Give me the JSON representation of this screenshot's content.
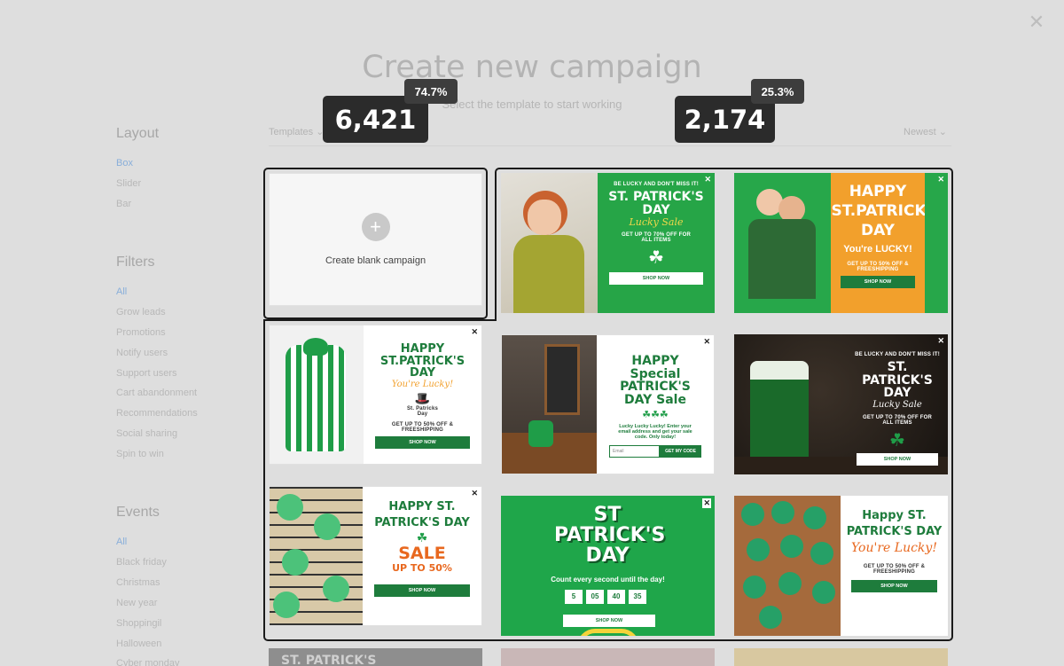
{
  "header": {
    "title": "Create new campaign",
    "subtitle": "Select the template to start working",
    "close_icon": "close-icon"
  },
  "stats": {
    "left": {
      "value": "6,421",
      "percent": "74.7%"
    },
    "right": {
      "value": "2,174",
      "percent": "25.3%"
    }
  },
  "sidebar": {
    "layout": {
      "heading": "Layout",
      "items": [
        "Box",
        "Slider",
        "Bar"
      ],
      "active": "Box"
    },
    "filters": {
      "heading": "Filters",
      "items": [
        "All",
        "Grow leads",
        "Promotions",
        "Notify users",
        "Support users",
        "Cart abandonment",
        "Recommendations",
        "Social sharing",
        "Spin to win"
      ],
      "active": "All"
    },
    "events": {
      "heading": "Events",
      "items": [
        "All",
        "Black friday",
        "Christmas",
        "New year",
        "Shoppingil",
        "Halloween",
        "Cyber monday"
      ],
      "active": "All"
    }
  },
  "toolbar": {
    "templates_label": "Templates",
    "sort_label": "Newest"
  },
  "blank_card": {
    "label": "Create blank campaign",
    "icon": "plus-icon"
  },
  "templates": {
    "t1": {
      "small": "BE LUCKY AND DON'T MISS IT!",
      "title": "ST. PATRICK'S DAY",
      "script": "Lucky Sale",
      "offer": "GET UP TO 70% OFF FOR ALL ITEMS",
      "button": "SHOP NOW"
    },
    "t2": {
      "title": "HAPPY ST.PATRICK'S DAY",
      "sub": "You're LUCKY!",
      "offer": "GET UP TO 50% OFF & FREESHIPPING",
      "button": "SHOP NOW"
    },
    "t3": {
      "title": "HAPPY ST.PATRICK'S DAY",
      "script": "You're Lucky!",
      "logo": "St. Patricks Day",
      "offer": "GET UP TO 50% OFF & FREESHIPPING",
      "button": "SHOP NOW"
    },
    "t4": {
      "title": "HAPPY Special PATRICK'S DAY Sale",
      "body": "Lucky Lucky Lucky! Enter your email address and get your sale code. Only today!",
      "input_placeholder": "Email",
      "button": "GET MY CODE"
    },
    "t5": {
      "small": "BE LUCKY AND DON'T MISS IT!",
      "title": "ST. PATRICK'S DAY",
      "script": "Lucky Sale",
      "offer": "GET UP TO 70% OFF FOR ALL ITEMS",
      "button": "SHOP NOW"
    },
    "t6": {
      "title": "HAPPY ST. PATRICK'S DAY",
      "sale": "SALE",
      "sale_sub": "UP TO 50%",
      "button": "SHOP NOW"
    },
    "t7": {
      "title": "ST PATRICK'S DAY",
      "countdown_label": "Count every second until the day!",
      "countdown": [
        "5",
        "05",
        "40",
        "35"
      ],
      "button": "SHOP NOW"
    },
    "t8": {
      "title": "Happy ST. PATRICK'S DAY",
      "script": "You're Lucky!",
      "offer": "GET UP TO 50% OFF & FREESHIPPING",
      "button": "SHOP NOW"
    }
  },
  "bottom_peek": {
    "text": "ST. PATRICK'S"
  },
  "colors": {
    "green": "#1f9d48",
    "dark_green": "#217a3a",
    "orange": "#f2a02c",
    "highlight": "#1a1a1a",
    "active_link": "#88aeda"
  }
}
